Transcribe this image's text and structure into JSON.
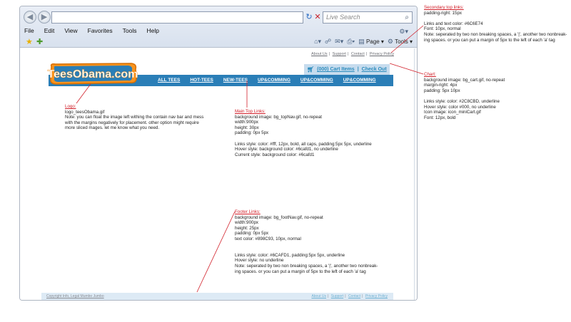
{
  "browser": {
    "back_glyph": "◀",
    "forward_glyph": "▶",
    "address_value": "",
    "search_placeholder": "Live Search",
    "menu": [
      "File",
      "Edit",
      "View",
      "Favorites",
      "Tools",
      "Help"
    ],
    "commands": {
      "page": "Page",
      "tools": "Tools"
    }
  },
  "site": {
    "logo_text": "TeesObama.com",
    "secondary_links": [
      "About Us",
      "Support",
      "Contact",
      "Privacy Policy"
    ],
    "cart_label": "(000) Cart Items",
    "checkout_label": "Check Out",
    "top_nav": [
      "ALL TEES",
      "HOT-TEES",
      "NEW-TEES",
      "UP&COMMING",
      "UP&COMMING",
      "UP&COMMING"
    ],
    "footer_left": "Copyright Info, Legal Mumbo Jumbo",
    "footer_links": [
      "About Us",
      "Support",
      "Contact",
      "Privacy Policy"
    ]
  },
  "notes": {
    "logo": {
      "heading": "Logo:",
      "lines": [
        "logo_teesObama.gif",
        "Note: you can float the image left withing the contain nav bar and mess",
        "with the margins negatively for placement. other option might require",
        "more sliced mages. let me know what you need."
      ]
    },
    "main_top": {
      "heading": "Main Top Links:",
      "lines": [
        "background image: bg_topNav.gif, no-repeat",
        "width:900px",
        "height: 30px",
        "padding: 0px 5px",
        "",
        "Links style: color: #fff, 12px, bold, all caps, padding:5px 5px, underline",
        "Hover style: background color: #6cafd1, no underline",
        "Current style: background color: #6cafd1"
      ]
    },
    "footer": {
      "heading": "Footer Links:",
      "lines": [
        "background image: bg_footNav.gif, no-repeat",
        "width:900px",
        "height: 25px",
        "padding: 0px 5px",
        "text color: #898C93, 10px, normal",
        "",
        "",
        "Links style: color: #6CAFD1, padding:5px 5px, underline",
        "Hover style: no underline",
        "Note: seperated by two non breaking spaces, a '|', another two nonbreak-",
        "ing spaces. or you can put a margin of 5px to the left of each 'a' tag"
      ]
    },
    "secondary": {
      "heading": "Secondary top links:",
      "lines": [
        "padding-right: 15px",
        "",
        "Links and text color: #6C6E74",
        "Font: 10px, normal",
        "Note: seperated by two non breaking spaces, a '|', another two nonbreak-",
        "ing spaces. or you can put a margin of 5px to the left of each 'a' tag"
      ]
    },
    "chart": {
      "heading": "Chart:",
      "lines": [
        "background image: bg_cart.gif, no-repeat",
        "margin-right: 4px",
        "padding: 5px 10px",
        "",
        "Links style: color: #2C8CBD, underline",
        "Hover style: color #000, no underline",
        "Icon image: icon_miniCart.gif",
        "Font: 12px, bold"
      ]
    }
  },
  "colors": {
    "annotation_heading": "#d2202a",
    "nav_bar": "#2a7eb7",
    "cart_link": "#2c8cbd",
    "footer_link": "#6cafd1",
    "secondary_link": "#6c6e74"
  }
}
